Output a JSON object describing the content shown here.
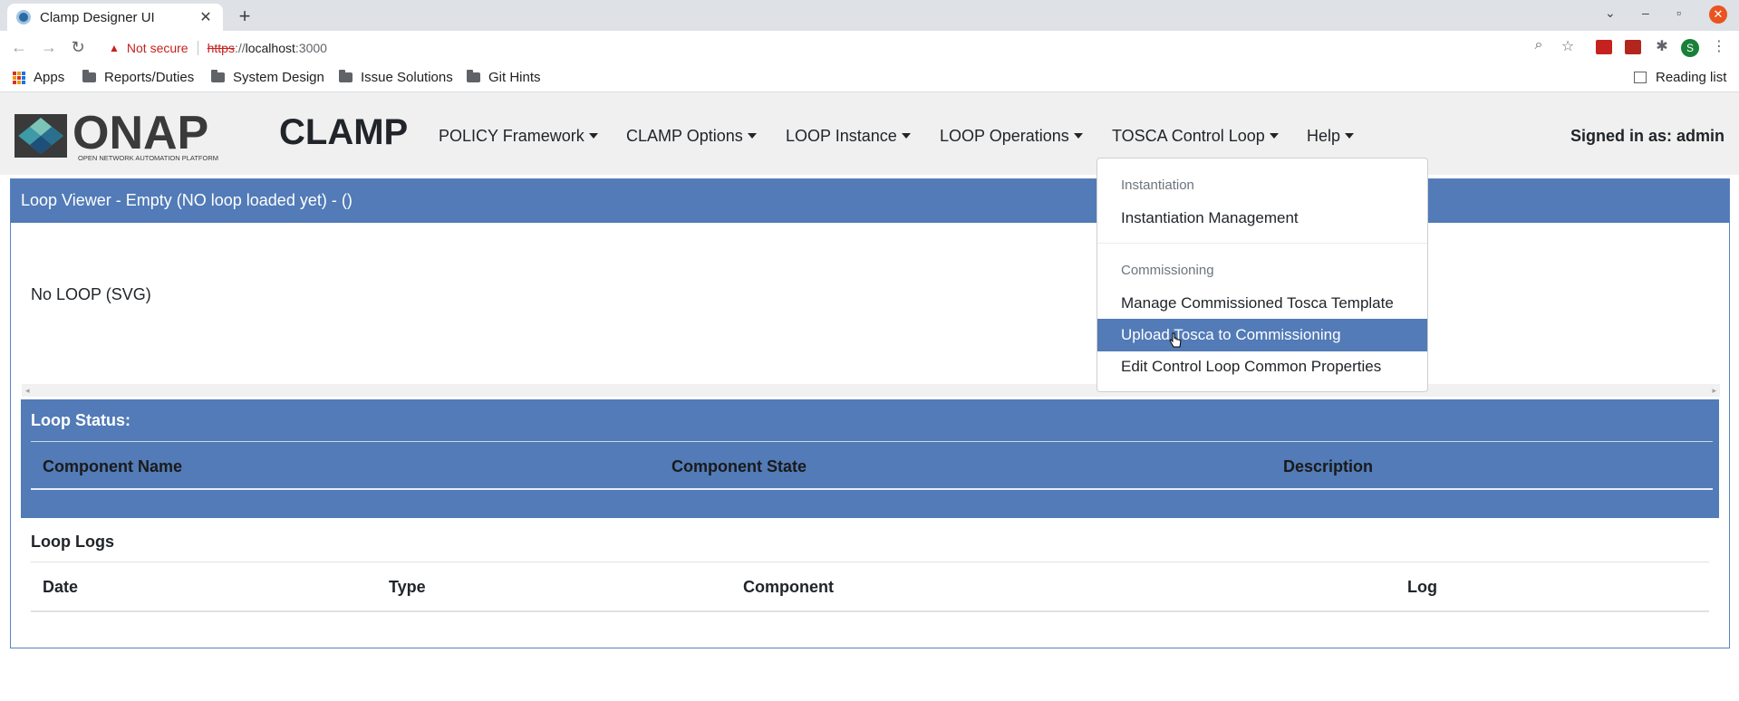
{
  "browser": {
    "tab_title": "Clamp Designer UI",
    "not_secure": "Not secure",
    "url_scheme": "https",
    "url_sep": "://",
    "url_host": "localhost",
    "url_port": ":3000",
    "profile_initial": "S",
    "bookmarks": [
      "Apps",
      "Reports/Duties",
      "System Design",
      "Issue Solutions",
      "Git Hints"
    ],
    "reading_list": "Reading list"
  },
  "app": {
    "logo_text": "ONAP",
    "logo_subtitle": "OPEN NETWORK AUTOMATION PLATFORM",
    "brand": "CLAMP",
    "menu": [
      "POLICY Framework",
      "CLAMP Options",
      "LOOP Instance",
      "LOOP Operations",
      "TOSCA Control Loop",
      "Help"
    ],
    "signed_in": "Signed in as: admin"
  },
  "loop_viewer": {
    "header": "Loop Viewer - Empty (NO loop loaded yet) - ()",
    "svg_placeholder": "No LOOP (SVG)"
  },
  "loop_status": {
    "title": "Loop Status:",
    "columns": [
      "Component Name",
      "Component State",
      "Description"
    ]
  },
  "loop_logs": {
    "title": "Loop Logs",
    "columns": [
      "Date",
      "Type",
      "Component",
      "Log"
    ]
  },
  "dropdown": {
    "section1": "Instantiation",
    "item1": "Instantiation Management",
    "section2": "Commissioning",
    "item2": "Manage Commissioned Tosca Template",
    "item3": "Upload Tosca to Commissioning",
    "item4": "Edit Control Loop Common Properties"
  },
  "colors": {
    "primary": "#527bb7",
    "nav_bg": "#f0f0f0"
  }
}
